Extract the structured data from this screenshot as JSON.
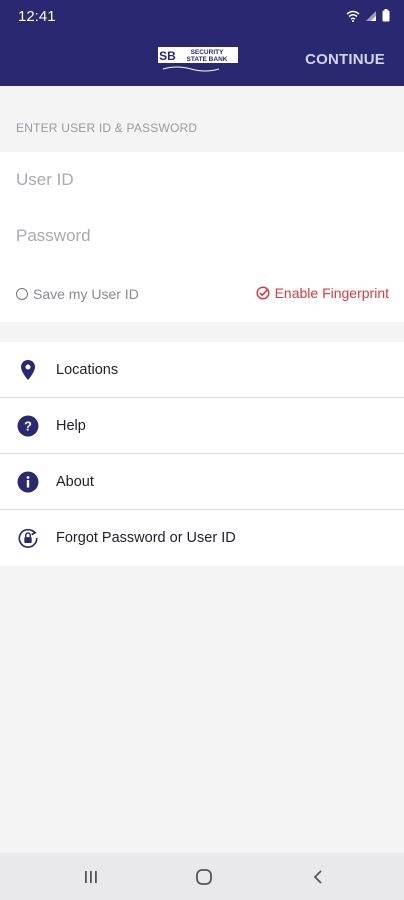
{
  "status_bar": {
    "time": "12:41"
  },
  "app_bar": {
    "logo_text": "SECURITY STATE BANK",
    "continue_label": "CONTINUE"
  },
  "login": {
    "section_title": "ENTER USER ID & PASSWORD",
    "user_id_placeholder": "User ID",
    "password_placeholder": "Password",
    "save_user_label": "Save my User ID",
    "fingerprint_label": "Enable Fingerprint"
  },
  "menu": {
    "items": [
      {
        "label": "Locations",
        "icon": "location-pin-icon"
      },
      {
        "label": "Help",
        "icon": "help-icon"
      },
      {
        "label": "About",
        "icon": "info-icon"
      },
      {
        "label": "Forgot Password or User ID",
        "icon": "lock-reset-icon"
      }
    ]
  },
  "colors": {
    "brand": "#2a2870",
    "accent_red": "#d63c3c",
    "background": "#f4f4f5"
  }
}
